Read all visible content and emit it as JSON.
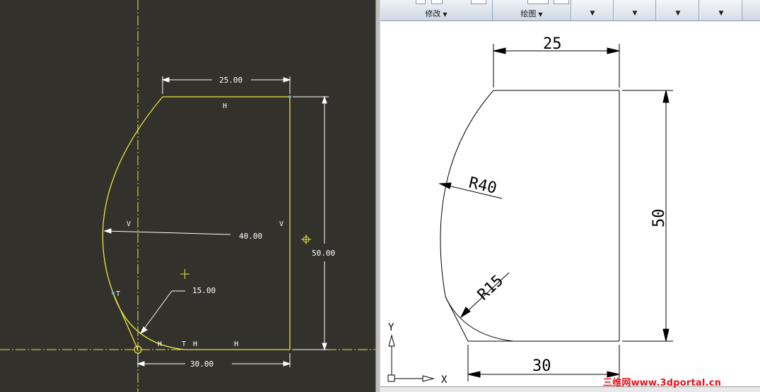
{
  "ribbon": {
    "groups": [
      {
        "label": "修改"
      },
      {
        "label": "绘图"
      }
    ],
    "dropdowns": 4
  },
  "sketch": {
    "dim_top": "25.00",
    "dim_right": "50.00",
    "dim_radius_large": "40.00",
    "dim_radius_small": "15.00",
    "dim_bottom": "30.00",
    "constraints": {
      "h_top": "H",
      "v_left": "V",
      "v_right": "V",
      "t_left": "T",
      "bottom_h1": "H",
      "bottom_t": "T",
      "bottom_h2": "H",
      "bottom_h3": "H"
    },
    "colors": {
      "background": "#33312b",
      "geometry": "#e8e640",
      "dimension": "#ffffff",
      "centerline": "#e8e640"
    }
  },
  "cad": {
    "dim_top": "25",
    "dim_right": "50",
    "dim_radius_large": "R40",
    "dim_radius_small": "R15",
    "dim_bottom": "30",
    "ucs_y": "Y",
    "ucs_x": "X"
  },
  "watermark": "三维网www.3dportal.cn"
}
